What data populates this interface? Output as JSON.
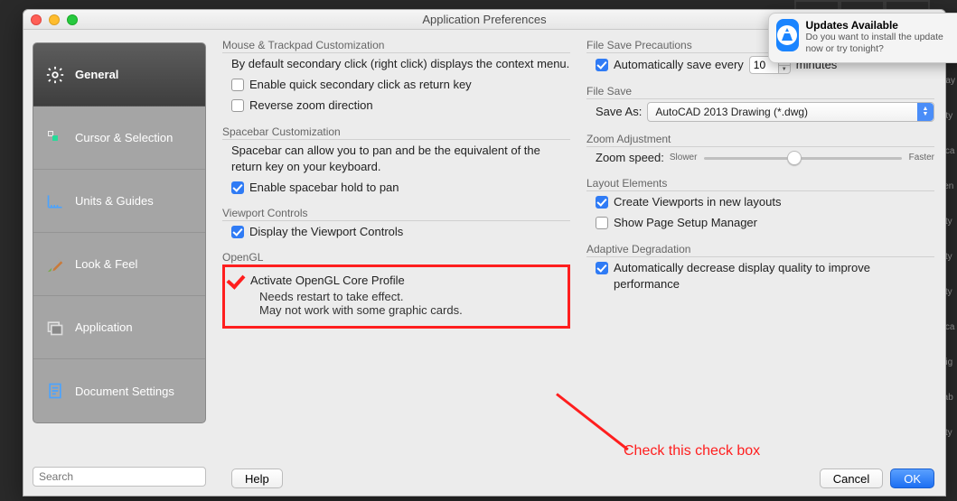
{
  "window": {
    "title": "Application Preferences"
  },
  "sidebar": {
    "items": [
      {
        "label": "General"
      },
      {
        "label": "Cursor & Selection"
      },
      {
        "label": "Units & Guides"
      },
      {
        "label": "Look & Feel"
      },
      {
        "label": "Application"
      },
      {
        "label": "Document Settings"
      }
    ],
    "search_placeholder": "Search"
  },
  "left": {
    "mouse": {
      "title": "Mouse & Trackpad Customization",
      "desc": "By default secondary click (right click) displays the context menu.",
      "quick_click": "Enable quick secondary click as return key",
      "reverse_zoom": "Reverse zoom direction"
    },
    "spacebar": {
      "title": "Spacebar Customization",
      "desc": "Spacebar can allow you to pan and be the equivalent of the return key on your keyboard.",
      "hold_to_pan": "Enable spacebar hold to pan"
    },
    "viewport": {
      "title": "Viewport Controls",
      "display": "Display the Viewport Controls"
    },
    "opengl": {
      "title": "OpenGL",
      "activate": "Activate OpenGL Core Profile",
      "note1": "Needs restart to take effect.",
      "note2": "May not work with some graphic cards."
    }
  },
  "right": {
    "file_precautions": {
      "title": "File Save Precautions",
      "autosave_label": "Automatically save every",
      "autosave_value": "10",
      "autosave_unit": "minutes"
    },
    "file_save": {
      "title": "File Save",
      "save_as_label": "Save As:",
      "save_as_value": "AutoCAD 2013 Drawing (*.dwg)"
    },
    "zoom": {
      "title": "Zoom Adjustment",
      "label": "Zoom speed:",
      "slow": "Slower",
      "fast": "Faster"
    },
    "layout": {
      "title": "Layout Elements",
      "create_vp": "Create Viewports in new layouts",
      "page_setup": "Show Page Setup Manager"
    },
    "adaptive": {
      "title": "Adaptive Degradation",
      "auto_decrease": "Automatically decrease display quality to improve performance"
    }
  },
  "buttons": {
    "help": "Help",
    "cancel": "Cancel",
    "ok": "OK"
  },
  "annotation": "Check this check box",
  "notification": {
    "title": "Updates Available",
    "body": "Do you want to install the update now or try tonight?"
  },
  "edge_labels": [
    "Lay",
    "ety",
    "sca",
    "ren",
    "sty",
    "sty",
    "sty",
    "sca",
    "eig",
    "tab",
    "sty"
  ]
}
